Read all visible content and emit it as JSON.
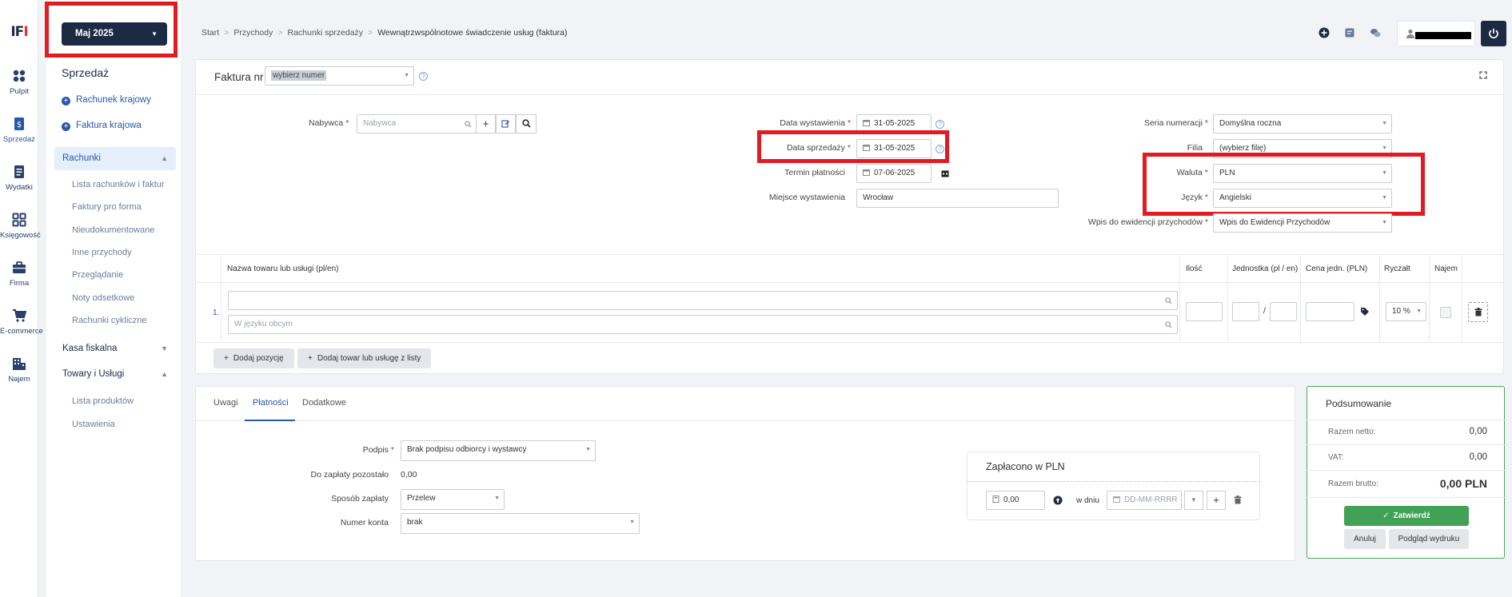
{
  "rail": {
    "logo_a": "IF",
    "logo_b": "I",
    "items": [
      {
        "label": "Pulpit",
        "icon": "dashboard-icon"
      },
      {
        "label": "Sprzedaż",
        "icon": "sales-icon"
      },
      {
        "label": "Wydatki",
        "icon": "expenses-icon"
      },
      {
        "label": "Księgowość",
        "icon": "accounting-icon"
      },
      {
        "label": "Firma",
        "icon": "briefcase-icon"
      },
      {
        "label": "E-commerce",
        "icon": "cart-icon"
      },
      {
        "label": "Najem",
        "icon": "building-icon"
      }
    ]
  },
  "sidebar": {
    "month": "Maj 2025",
    "title": "Sprzedaż",
    "links": [
      "Rachunek krajowy",
      "Faktura krajowa"
    ],
    "sections": {
      "rachunki": "Rachunki",
      "kasa": "Kasa fiskalna",
      "towary": "Towary i Usługi"
    },
    "rachunki_items": [
      "Lista rachunków i faktur",
      "Faktury pro forma",
      "Nieudokumentowane",
      "Inne przychody",
      "Przeglądanie",
      "Noty odsetkowe",
      "Rachunki cykliczne"
    ],
    "towary_items": [
      "Lista produktów",
      "Ustawienia"
    ]
  },
  "breadcrumb": [
    "Start",
    "Przychody",
    "Rachunki sprzedaży",
    "Wewnątrzwspólnotowe świadczenie usług (faktura)"
  ],
  "invoice": {
    "faktura_label": "Faktura nr",
    "faktura_select": "wybierz numer",
    "nabywca_label": "Nabywca",
    "nabywca_placeholder": "Nabywca",
    "data_wystawienia_label": "Data wystawienia",
    "data_wystawienia": "31-05-2025",
    "data_sprzedazy_label": "Data sprzedaży",
    "data_sprzedazy": "31-05-2025",
    "termin_label": "Termin płatności",
    "termin": "07-06-2025",
    "miejsce_label": "Miejsce wystawienia",
    "miejsce": "Wrocław",
    "seria_label": "Seria numeracji",
    "seria": "Domyślna roczna",
    "filia_label": "Filia",
    "filia": "(wybierz filię)",
    "waluta_label": "Waluta",
    "waluta": "PLN",
    "jezyk_label": "Język",
    "jezyk": "Angielski",
    "wpis_label": "Wpis do ewidencji przychodów",
    "wpis": "Wpis do Ewidencji Przychodów"
  },
  "items_table": {
    "headers": {
      "name": "Nazwa towaru lub usługi (pl/en)",
      "qty": "Ilość",
      "unit": "Jednostka (pl / en)",
      "price": "Cena jedn. (PLN)",
      "ryczalt": "Ryczałt",
      "najem": "Najem"
    },
    "row_no": "1.",
    "foreign_placeholder": "W języku obcym",
    "unit_sep": "/",
    "ryczalt_value": "10 %",
    "add_position": "Dodaj pozycję",
    "add_from_list": "Dodaj towar lub usługę z listy"
  },
  "tabs": [
    "Uwagi",
    "Płatności",
    "Dodatkowe"
  ],
  "payments": {
    "podpis_label": "Podpis",
    "podpis": "Brak podpisu odbiorcy i wystawcy",
    "do_zaplaty_label": "Do zapłaty pozostało",
    "do_zaplaty": "0,00",
    "sposob_label": "Sposób zapłaty",
    "sposob": "Przelew",
    "konto_label": "Numer konta",
    "konto": "brak",
    "zaplacono_title": "Zapłacono w PLN",
    "zaplacono_value": "0,00",
    "w_dniu": "w dniu",
    "date_placeholder": "DD-MM-RRRR"
  },
  "summary": {
    "title": "Podsumowanie",
    "netto_label": "Razem netto:",
    "netto": "0,00",
    "vat_label": "VAT:",
    "vat": "0,00",
    "brutto_label": "Razem brutto:",
    "brutto": "0,00 PLN",
    "confirm": "Zatwierdź",
    "cancel": "Anuluj",
    "preview": "Podgląd wydruku"
  },
  "colors": {
    "highlight": "#e11b22",
    "brand": "#1d2a44",
    "accent": "#2a58a8",
    "confirm": "#41a155"
  }
}
